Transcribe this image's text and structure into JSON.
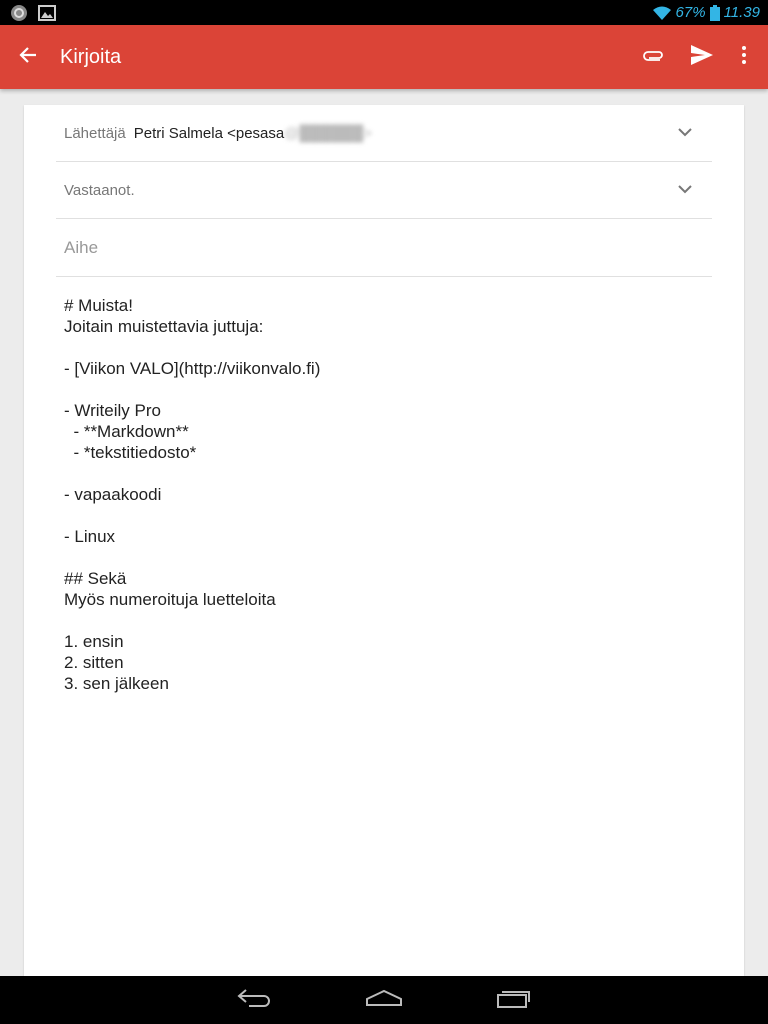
{
  "status_bar": {
    "battery": "67%",
    "time": "11.39"
  },
  "app_bar": {
    "title": "Kirjoita"
  },
  "compose": {
    "from_label": "Lähettäjä",
    "from_value": "Petri Salmela <pesasa",
    "from_blurred": "@██████>",
    "to_label": "Vastaanot.",
    "subject_placeholder": "Aihe",
    "body": "# Muista!\nJoitain muistettavia juttuja:\n\n- [Viikon VALO](http://viikonvalo.fi)\n\n- Writeily Pro\n  - **Markdown**\n  - *tekstitiedosto*\n\n- vapaakoodi\n\n- Linux\n\n## Sekä\nMyös numeroituja luetteloita\n\n1. ensin\n2. sitten\n3. sen jälkeen"
  },
  "icons": {
    "back": "arrow-back-icon",
    "attach": "paperclip-icon",
    "send": "send-icon",
    "more": "more-vert-icon",
    "expand": "chevron-down-icon"
  },
  "colors": {
    "app_bar": "#db4437",
    "status_accent": "#33b5e5"
  }
}
